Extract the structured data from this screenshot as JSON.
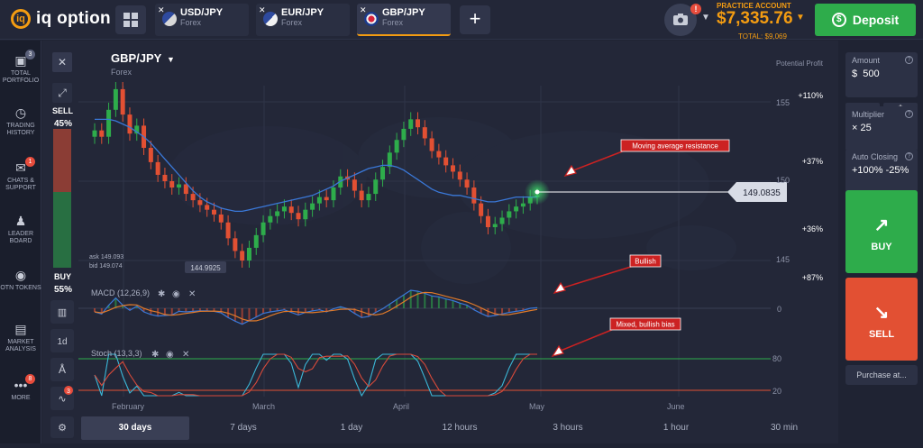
{
  "header": {
    "logo_text": "iq option",
    "tabs": [
      {
        "name": "USD/JPY",
        "type": "Forex",
        "active": false
      },
      {
        "name": "EUR/JPY",
        "type": "Forex",
        "active": false
      },
      {
        "name": "GBP/JPY",
        "type": "Forex",
        "active": true
      }
    ],
    "camera_badge": "!",
    "account_label": "PRACTICE ACCOUNT",
    "balance": "$7,335.76",
    "total": "TOTAL: $9,069",
    "deposit_label": "Deposit"
  },
  "sidebar": {
    "items": [
      {
        "label": "TOTAL PORTFOLIO",
        "badge": "3",
        "icon": "briefcase-icon"
      },
      {
        "label": "TRADING HISTORY",
        "badge": "",
        "icon": "history-icon"
      },
      {
        "label": "CHATS & SUPPORT",
        "badge": "1",
        "icon": "chat-icon"
      },
      {
        "label": "LEADER BOARD",
        "badge": "",
        "icon": "leader-icon"
      },
      {
        "label": "OTN TOKENS",
        "badge": "",
        "icon": "token-icon"
      },
      {
        "label": "MARKET ANALYSIS",
        "badge": "",
        "icon": "analysis-icon"
      },
      {
        "label": "MORE",
        "badge": "8",
        "icon": "more-icon"
      }
    ]
  },
  "chart": {
    "asset": "GBP/JPY",
    "asset_type": "Forex",
    "sell_label": "SELL",
    "sell_pct": "45%",
    "buy_label": "BUY",
    "buy_pct": "55%",
    "ask": "ask 149.093",
    "bid": "bid 149.074",
    "low_label": "144.9925",
    "current_price": "149.0835",
    "price_ticks": [
      "155",
      "150",
      "145"
    ],
    "macd_label": "MACD (12,26,9)",
    "macd_zero": "0",
    "stoch_label": "Stoch (13,3,3)",
    "stoch_ticks": [
      "80",
      "20"
    ],
    "month_labels": [
      "February",
      "March",
      "April",
      "May",
      "June"
    ],
    "potential_profit_label": "Potential Profit",
    "profit_levels": [
      "+110%",
      "+37%",
      "+36%",
      "+87%"
    ],
    "annotations": [
      "Moving average resistance",
      "Bullish",
      "Mixed, bullish bias"
    ],
    "timeframe_btn": "1d",
    "tool_badge": "3",
    "timeframes": [
      "30 days",
      "7 days",
      "1 day",
      "12 hours",
      "3 hours",
      "1 hour",
      "30 min"
    ],
    "active_timeframe": "30 days",
    "colors": {
      "up": "#2eac4b",
      "down": "#e25033",
      "ma": "#3a78d8",
      "macd_signal": "#e07a2a",
      "stoch_k": "#3bb8d8",
      "stoch_d": "#d84a3a"
    }
  },
  "chart_data": {
    "type": "candlestick",
    "title": "GBP/JPY",
    "x_labels": [
      "February",
      "March",
      "April",
      "May",
      "June"
    ],
    "ylim": [
      144,
      157
    ],
    "closes": [
      153.2,
      152.8,
      154.5,
      155.8,
      154.2,
      153.0,
      153.5,
      152.1,
      151.2,
      150.4,
      150.0,
      149.6,
      149.8,
      149.2,
      148.8,
      148.5,
      148.2,
      147.9,
      147.4,
      146.4,
      145.6,
      145.0,
      145.8,
      146.6,
      147.4,
      147.8,
      148.1,
      148.4,
      148.0,
      147.6,
      148.2,
      148.6,
      149.0,
      148.8,
      149.6,
      150.3,
      150.1,
      149.4,
      148.8,
      149.2,
      150.1,
      150.9,
      151.8,
      152.6,
      153.3,
      153.9,
      153.4,
      152.7,
      151.9,
      151.5,
      151.0,
      150.6,
      150.1,
      149.6,
      148.6,
      147.8,
      147.1,
      147.3,
      147.7,
      148.1,
      148.4,
      148.6,
      149.0,
      149.1
    ],
    "ma_values": [
      153.9,
      153.9,
      153.9,
      153.8,
      153.6,
      153.4,
      153.1,
      152.8,
      152.4,
      151.9,
      151.4,
      150.9,
      150.4,
      149.9,
      149.4,
      149.0,
      148.7,
      148.5,
      148.3,
      148.2,
      148.1,
      148.1,
      148.2,
      148.3,
      148.4,
      148.5,
      148.6,
      148.7,
      148.8,
      148.9,
      149.0,
      149.1,
      149.3,
      149.5,
      149.7,
      150.0,
      150.2,
      150.4,
      150.6,
      150.8,
      150.9,
      151.0,
      151.0,
      150.9,
      150.7,
      150.4,
      150.1,
      149.8,
      149.5,
      149.3,
      149.2,
      149.1,
      149.1,
      149.0,
      148.9,
      148.8,
      148.7,
      148.7,
      148.8,
      148.9,
      149.0,
      149.0,
      149.0,
      149.0
    ]
  }
}
